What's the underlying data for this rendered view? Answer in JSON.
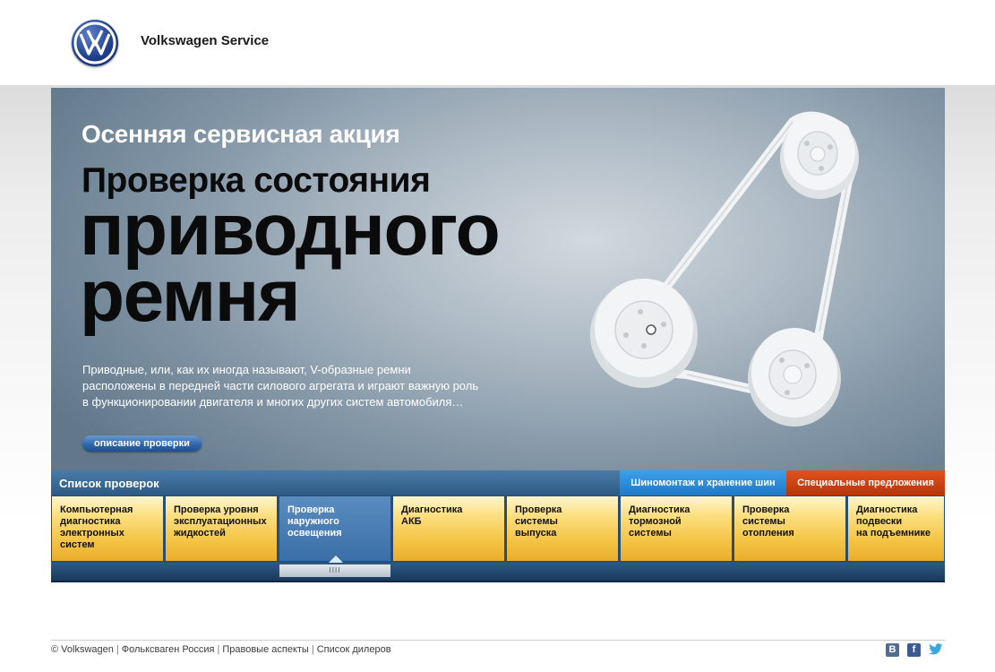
{
  "header": {
    "brand": "Volkswagen Service",
    "logo_icon": "vw-logo-icon"
  },
  "hero": {
    "kicker": "Осенняя сервисная акция",
    "title_line1": "Проверка состояния",
    "title_line2": "приводного",
    "title_line3": "ремня",
    "description": "Приводные, или, как их иногда называют, V-образные ремни расположены в передней части силового агрегата и играют важную роль в функционировании двигателя и многих других систем автомобиля…",
    "button_label": "описание проверки",
    "image_icon": "drive-belt-icon"
  },
  "checks": {
    "title": "Список проверок",
    "tab_tires": "Шиномонтаж и хранение шин",
    "tab_special": "Специальные предложения",
    "items": [
      {
        "lines": [
          "Компьютерная",
          "диагностика",
          "электронных",
          "систем"
        ],
        "active": false
      },
      {
        "lines": [
          "Проверка уровня",
          "эксплуатационных",
          "жидкостей"
        ],
        "active": false
      },
      {
        "lines": [
          "Проверка",
          "наружного",
          "освещения"
        ],
        "active": true
      },
      {
        "lines": [
          "Диагностика",
          "АКБ"
        ],
        "active": false
      },
      {
        "lines": [
          "Проверка",
          "системы",
          "выпуска"
        ],
        "active": false
      },
      {
        "lines": [
          "Диагностика",
          "тормозной",
          "системы"
        ],
        "active": false
      },
      {
        "lines": [
          "Проверка",
          "системы",
          "отопления"
        ],
        "active": false
      },
      {
        "lines": [
          "Диагностика",
          "подвески",
          "на подъемнике"
        ],
        "active": false
      }
    ],
    "scroll_handle": "IIII"
  },
  "footer": {
    "links": [
      "© Volkswagen",
      "Фольксваген Россия",
      "Правовые аспекты",
      "Список дилеров"
    ],
    "social": [
      {
        "name": "vkontakte-icon",
        "glyph": "В"
      },
      {
        "name": "facebook-icon",
        "glyph": "f"
      },
      {
        "name": "twitter-icon",
        "glyph": "🐦"
      }
    ]
  },
  "colors": {
    "tile_yellow": "#f4c344",
    "tile_active": "#3a6fa7",
    "tab_tires": "#1f79c8",
    "tab_special": "#b73408"
  }
}
